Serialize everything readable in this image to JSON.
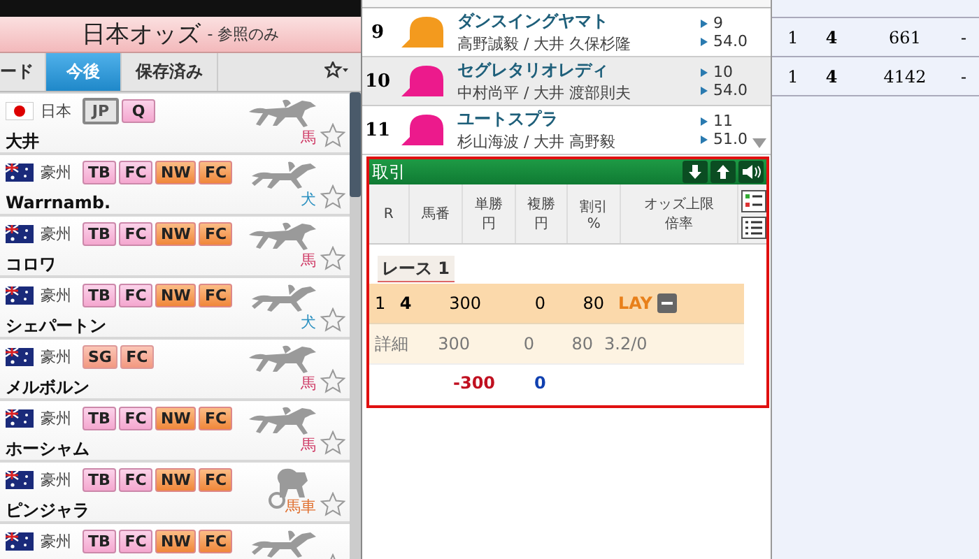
{
  "header": {
    "title": "日本オッズ",
    "subtitle": "- 参照のみ"
  },
  "tabs": [
    {
      "label": "ード",
      "selected": false
    },
    {
      "label": "今後",
      "selected": true
    },
    {
      "label": "保存済み",
      "selected": false
    }
  ],
  "venues": [
    {
      "flag": {
        "kind": "jp"
      },
      "country": "日本",
      "tags": [
        {
          "label": "JP",
          "kind": "grey"
        },
        {
          "label": "Q",
          "kind": "pink"
        }
      ],
      "name": "大井",
      "kind": "horse",
      "type": "馬"
    },
    {
      "flag": {
        "kind": "au"
      },
      "country": "豪州",
      "tags": [
        {
          "label": "TB",
          "kind": "pink"
        },
        {
          "label": "FC",
          "kind": "pink"
        },
        {
          "label": "NW",
          "kind": "orange"
        },
        {
          "label": "FC",
          "kind": "orange"
        }
      ],
      "name": "Warrnamb.",
      "kind": "dog",
      "type": "犬"
    },
    {
      "flag": {
        "kind": "au"
      },
      "country": "豪州",
      "tags": [
        {
          "label": "TB",
          "kind": "pink"
        },
        {
          "label": "FC",
          "kind": "pink"
        },
        {
          "label": "NW",
          "kind": "orange"
        },
        {
          "label": "FC",
          "kind": "orange"
        }
      ],
      "name": "コロワ",
      "kind": "horse",
      "type": "馬"
    },
    {
      "flag": {
        "kind": "au"
      },
      "country": "豪州",
      "tags": [
        {
          "label": "TB",
          "kind": "pink"
        },
        {
          "label": "FC",
          "kind": "pink"
        },
        {
          "label": "NW",
          "kind": "orange"
        },
        {
          "label": "FC",
          "kind": "orange"
        }
      ],
      "name": "シェパートン",
      "kind": "dog",
      "type": "犬"
    },
    {
      "flag": {
        "kind": "au"
      },
      "country": "豪州",
      "tags": [
        {
          "label": "SG",
          "kind": "salmon"
        },
        {
          "label": "FC",
          "kind": "salmon"
        }
      ],
      "name": "メルボルン",
      "kind": "horse",
      "type": "馬"
    },
    {
      "flag": {
        "kind": "au"
      },
      "country": "豪州",
      "tags": [
        {
          "label": "TB",
          "kind": "pink"
        },
        {
          "label": "FC",
          "kind": "pink"
        },
        {
          "label": "NW",
          "kind": "orange"
        },
        {
          "label": "FC",
          "kind": "orange"
        }
      ],
      "name": "ホーシャム",
      "kind": "horse",
      "type": "馬"
    },
    {
      "flag": {
        "kind": "au"
      },
      "country": "豪州",
      "tags": [
        {
          "label": "TB",
          "kind": "pink"
        },
        {
          "label": "FC",
          "kind": "pink"
        },
        {
          "label": "NW",
          "kind": "orange"
        },
        {
          "label": "FC",
          "kind": "orange"
        }
      ],
      "name": "ピンジャラ",
      "kind": "harness",
      "type": "馬車"
    },
    {
      "flag": {
        "kind": "au"
      },
      "country": "豪州",
      "tags": [
        {
          "label": "TB",
          "kind": "pink"
        },
        {
          "label": "FC",
          "kind": "pink"
        },
        {
          "label": "NW",
          "kind": "orange"
        },
        {
          "label": "FC",
          "kind": "orange"
        }
      ],
      "kind": "dog"
    }
  ],
  "runners": [
    {
      "number": "9",
      "color": "#f39a1e",
      "horse": "ダンスイングヤマト",
      "jockey": "高野誠毅 / 大井 久保杉隆",
      "gate": "9",
      "weight": "54.0"
    },
    {
      "number": "10",
      "color": "#ec1a8c",
      "horse": "セグレタリオレディ",
      "jockey": "中村尚平 / 大井 渡部則夫",
      "gate": "10",
      "weight": "54.0"
    },
    {
      "number": "11",
      "color": "#ec1a8c",
      "horse": "ユートスプラ",
      "jockey": "杉山海波 / 大井 高野毅",
      "gate": "11",
      "weight": "51.0"
    }
  ],
  "trade": {
    "title": "取引",
    "columns": [
      [
        "R"
      ],
      [
        "馬番"
      ],
      [
        "単勝",
        "円"
      ],
      [
        "複勝",
        "円"
      ],
      [
        "割引",
        "%"
      ],
      [
        "オッズ上限",
        "倍率"
      ]
    ],
    "race": "レース 1",
    "bet": {
      "cells": [
        "1",
        "4",
        "300",
        "0",
        "80"
      ],
      "side": "LAY"
    },
    "detail": [
      "詳細",
      "300",
      "0",
      "80",
      "3.2/0"
    ],
    "totals": {
      "win": "-300",
      "place": "0"
    }
  },
  "results": [
    [
      "1",
      "4",
      "661",
      "-"
    ],
    [
      "1",
      "4",
      "4142",
      "-"
    ]
  ]
}
